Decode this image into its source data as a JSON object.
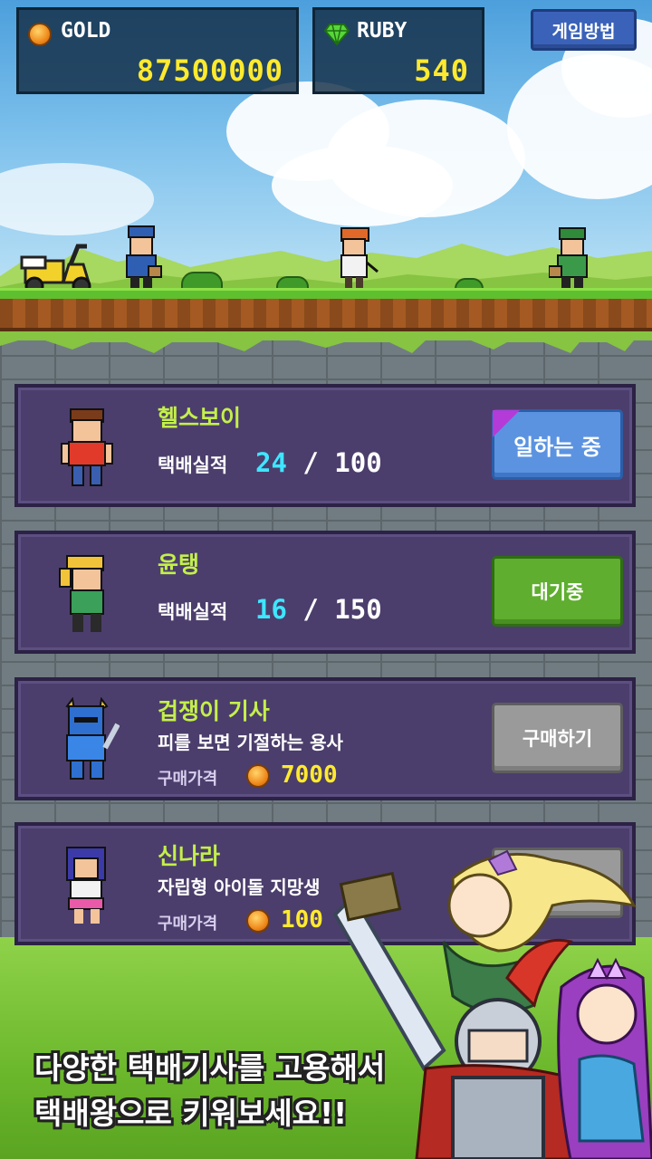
{
  "currency": {
    "gold": {
      "label": "GOLD",
      "value": "87500000"
    },
    "ruby": {
      "label": "RUBY",
      "value": "540"
    }
  },
  "help_button": {
    "label": "게임방법"
  },
  "couriers": [
    {
      "name": "헬스보이",
      "stat_label": "택배실적",
      "stat_current": "24",
      "stat_rest": " / 100",
      "action": "일하는 중"
    },
    {
      "name": "윤탱",
      "stat_label": "택배실적",
      "stat_current": "16",
      "stat_rest": " / 150",
      "action": "대기중"
    },
    {
      "name": "겁쟁이 기사",
      "description": "피를 보면 기절하는 용사",
      "price_label": "구매가격",
      "price": "7000",
      "action": "구매하기"
    },
    {
      "name": "신나라",
      "description": "자립형 아이돌 지망생",
      "price_label": "구매가격",
      "price": "100"
    }
  ],
  "promo": {
    "line1": "다양한 택배기사를 고용해서",
    "line2": "택배왕으로 키워보세요!!"
  },
  "colors": {
    "accent_name": "#c4f04a",
    "gold_value": "#ffea2e",
    "stat_value": "#3ee6ff",
    "card_bg": "#4b3e6c"
  }
}
